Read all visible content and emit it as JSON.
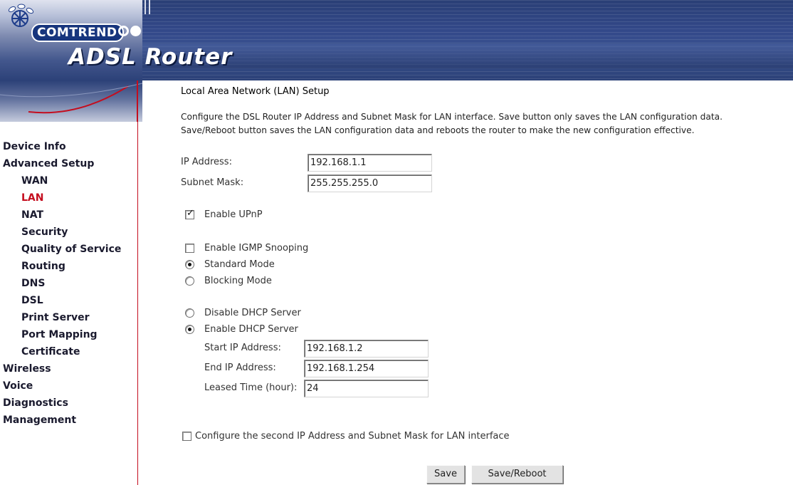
{
  "header": {
    "brand": "COMTREND",
    "product": "ADSL Router"
  },
  "sidebar": {
    "items": [
      {
        "label": "Device Info",
        "level": 0,
        "active": false
      },
      {
        "label": "Advanced Setup",
        "level": 0,
        "active": false
      },
      {
        "label": "WAN",
        "level": 1,
        "active": false
      },
      {
        "label": "LAN",
        "level": 1,
        "active": true
      },
      {
        "label": "NAT",
        "level": 1,
        "active": false
      },
      {
        "label": "Security",
        "level": 1,
        "active": false
      },
      {
        "label": "Quality of Service",
        "level": 1,
        "active": false
      },
      {
        "label": "Routing",
        "level": 1,
        "active": false
      },
      {
        "label": "DNS",
        "level": 1,
        "active": false
      },
      {
        "label": "DSL",
        "level": 1,
        "active": false
      },
      {
        "label": "Print Server",
        "level": 1,
        "active": false
      },
      {
        "label": "Port Mapping",
        "level": 1,
        "active": false
      },
      {
        "label": "Certificate",
        "level": 1,
        "active": false
      },
      {
        "label": "Wireless",
        "level": 0,
        "active": false
      },
      {
        "label": "Voice",
        "level": 0,
        "active": false
      },
      {
        "label": "Diagnostics",
        "level": 0,
        "active": false
      },
      {
        "label": "Management",
        "level": 0,
        "active": false
      }
    ],
    "active_color": "#c40d1e"
  },
  "main": {
    "title": "Local Area Network (LAN) Setup",
    "desc_line1": "Configure the DSL Router IP Address and Subnet Mask for LAN interface.  Save button only saves the LAN configuration data.",
    "desc_line2": "Save/Reboot button saves the LAN configuration data and reboots the router to make the new configuration effective.",
    "ip_label": "IP Address:",
    "ip_value": "192.168.1.1",
    "mask_label": "Subnet Mask:",
    "mask_value": "255.255.255.0",
    "upnp_label": "Enable UPnP",
    "upnp_checked": true,
    "igmp_label": "Enable IGMP Snooping",
    "igmp_checked": false,
    "standard_mode_label": "Standard Mode",
    "blocking_mode_label": "Blocking Mode",
    "igmp_mode_selected": "Standard Mode",
    "disable_dhcp_label": "Disable DHCP Server",
    "enable_dhcp_label": "Enable DHCP Server",
    "dhcp_selected": "Enable DHCP Server",
    "start_ip_label": "Start IP Address:",
    "start_ip_value": "192.168.1.2",
    "end_ip_label": "End IP Address:",
    "end_ip_value": "192.168.1.254",
    "lease_label": "Leased Time (hour):",
    "lease_value": "24",
    "second_ip_label": "Configure the second IP Address and Subnet Mask for LAN interface",
    "second_ip_checked": false,
    "save_label": "Save",
    "save_reboot_label": "Save/Reboot"
  }
}
